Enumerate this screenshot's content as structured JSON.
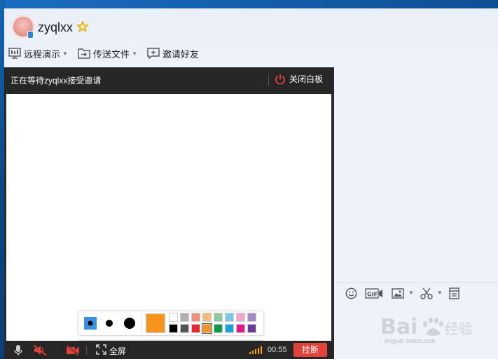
{
  "header": {
    "username": "zyqlxx"
  },
  "toolbar": {
    "remote_demo": "远程演示",
    "send_file": "传送文件",
    "invite_friend": "邀请好友"
  },
  "whiteboard": {
    "status_text": "正在等待zyqlxx接受邀请",
    "close_label": "关闭白板",
    "current_color": "#f7941d",
    "swatches_top": [
      "#ffffff",
      "#b0b0b0",
      "#f0907a",
      "#f5b97a",
      "#8cc9a0",
      "#7dc9ec",
      "#f3a6c9",
      "#a889c7"
    ],
    "swatches_bottom": [
      "#000000",
      "#555555",
      "#e8262b",
      "#f7941d",
      "#0a9a4a",
      "#17a1e0",
      "#e4148b",
      "#6a3a98"
    ],
    "tools": [
      "text-tool-icon",
      "pencil-icon",
      "arrow-icon",
      "rectangle-icon",
      "ellipse-icon",
      "eraser-icon",
      "save-icon"
    ]
  },
  "call_bar": {
    "fullscreen_label": "全屏",
    "timer": "00:55",
    "hangup_label": "挂断"
  },
  "watermark": {
    "url": "jingyan.baidu.com"
  }
}
